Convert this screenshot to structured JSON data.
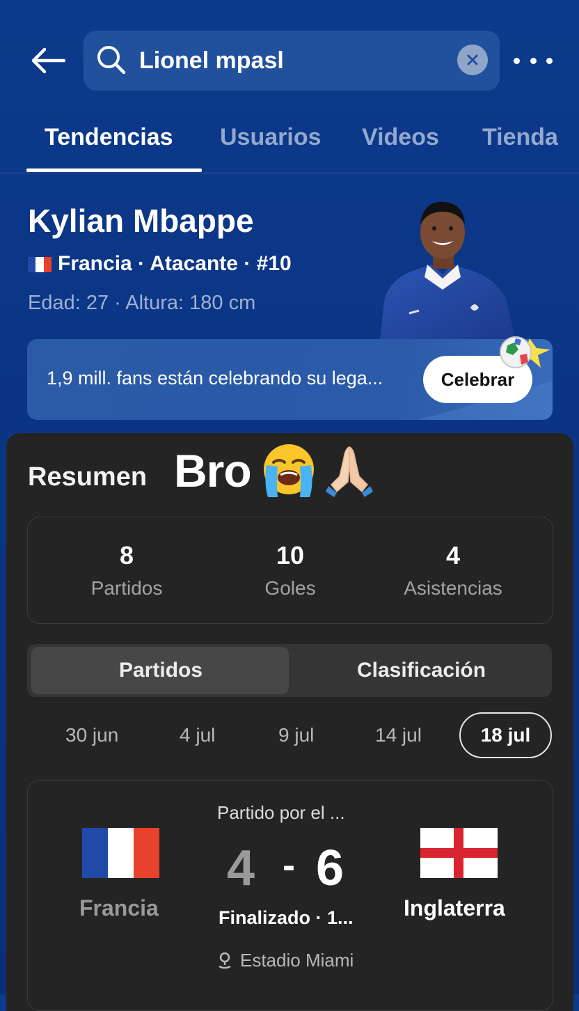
{
  "search": {
    "query": "Lionel mpasl"
  },
  "tabs": [
    {
      "label": "Tendencias",
      "active": true
    },
    {
      "label": "Usuarios",
      "active": false
    },
    {
      "label": "Videos",
      "active": false
    },
    {
      "label": "Tienda",
      "active": false
    }
  ],
  "player": {
    "name": "Kylian Mbappe",
    "meta": "Francia · Atacante · #10",
    "extra": "Edad: 27 · Altura: 180 cm"
  },
  "banner": {
    "text": "1,9 mill. fans están celebrando su lega...",
    "button": "Celebrar"
  },
  "summary": {
    "title": "Resumen",
    "overlay_text": "Bro",
    "overlay_emojis": [
      "loudly-crying-face",
      "folded-hands"
    ],
    "stats": [
      {
        "value": "8",
        "label": "Partidos"
      },
      {
        "value": "10",
        "label": "Goles"
      },
      {
        "value": "4",
        "label": "Asistencias"
      }
    ]
  },
  "segmented": [
    {
      "label": "Partidos",
      "active": true
    },
    {
      "label": "Clasificación",
      "active": false
    }
  ],
  "dates": [
    {
      "label": "30 jun",
      "active": false
    },
    {
      "label": "4 jul",
      "active": false
    },
    {
      "label": "9 jul",
      "active": false
    },
    {
      "label": "14 jul",
      "active": false
    },
    {
      "label": "18 jul",
      "active": true
    }
  ],
  "match": {
    "round": "Partido por el ...",
    "home": {
      "name": "Francia",
      "score": "4"
    },
    "away": {
      "name": "Inglaterra",
      "score": "6"
    },
    "separator": "-",
    "status": "Finalizado · 1...",
    "venue": "Estadio Miami"
  },
  "colors": {
    "background": "#0b3584",
    "search_box": "#21509c",
    "panel": "#242424",
    "flag_blue": "#1f4aa8",
    "flag_red": "#e8412c",
    "england_red": "#d8252f"
  }
}
